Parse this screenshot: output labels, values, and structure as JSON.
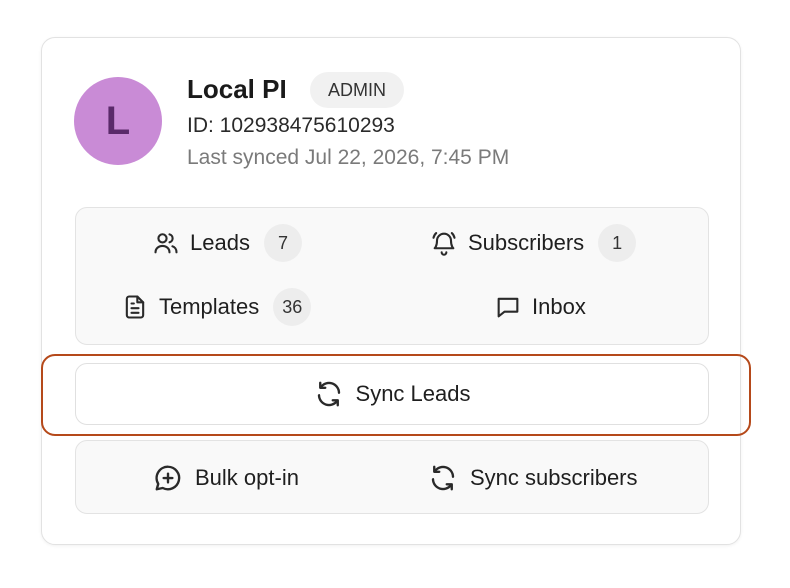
{
  "profile": {
    "avatar_letter": "L",
    "name": "Local PI",
    "role": "ADMIN",
    "id_text": "ID: 102938475610293",
    "last_synced": "Last synced Jul 22, 2026, 7:45 PM"
  },
  "stats": {
    "leads": {
      "label": "Leads",
      "count": "7",
      "icon": "users-icon"
    },
    "subscribers": {
      "label": "Subscribers",
      "count": "1",
      "icon": "bell-ring-icon"
    },
    "templates": {
      "label": "Templates",
      "count": "36",
      "icon": "file-text-icon"
    },
    "inbox": {
      "label": "Inbox",
      "icon": "message-square-icon"
    }
  },
  "sync_leads": {
    "label": "Sync Leads",
    "icon": "refresh-icon"
  },
  "actions": {
    "bulk_opt_in": {
      "label": "Bulk opt-in",
      "icon": "message-plus-icon"
    },
    "sync_subscribers": {
      "label": "Sync subscribers",
      "icon": "refresh-icon"
    }
  },
  "colors": {
    "avatar_bg": "#c98bd6",
    "avatar_letter": "#5a2a6a",
    "highlight_border": "#b5491a"
  }
}
